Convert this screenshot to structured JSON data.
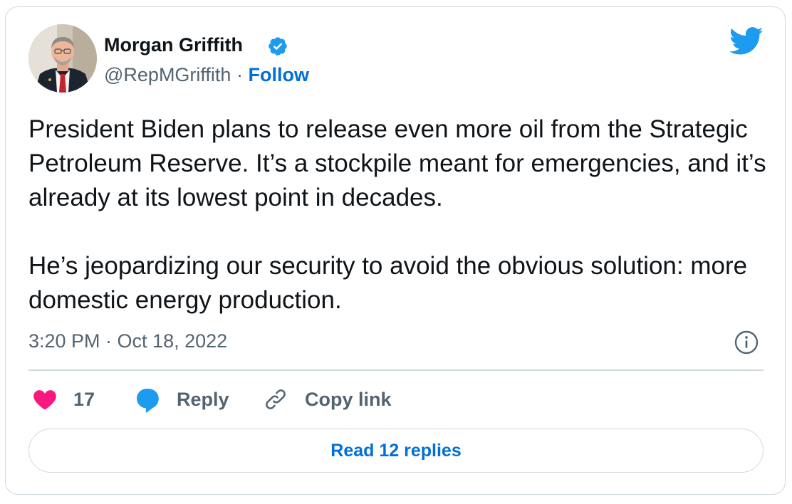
{
  "author": {
    "name": "Morgan Griffith",
    "handle": "@RepMGriffith",
    "separator": "·",
    "follow_label": "Follow",
    "verified": true
  },
  "tweet": {
    "text": "President Biden plans to release even more oil from the Strategic Petroleum Reserve. It’s a stockpile meant for emergencies, and it’s already at its lowest point in decades.\n\nHe’s jeopardizing our security to avoid the obvious solution: more domestic energy production.",
    "timestamp": "3:20 PM · Oct 18, 2022"
  },
  "actions": {
    "like_count": "17",
    "reply_label": "Reply",
    "copy_link_label": "Copy link"
  },
  "footer": {
    "read_replies_label": "Read 12 replies"
  },
  "icons": {
    "brand": "twitter-bird-icon",
    "verified": "verified-badge-icon",
    "info": "info-icon",
    "like": "heart-icon",
    "reply": "speech-bubble-icon",
    "copy": "link-icon"
  },
  "colors": {
    "brand_blue": "#1d9bf0",
    "link_blue": "#006fd6",
    "heart_pink": "#f91880",
    "secondary_text": "#536471",
    "border": "#cfd9de"
  }
}
